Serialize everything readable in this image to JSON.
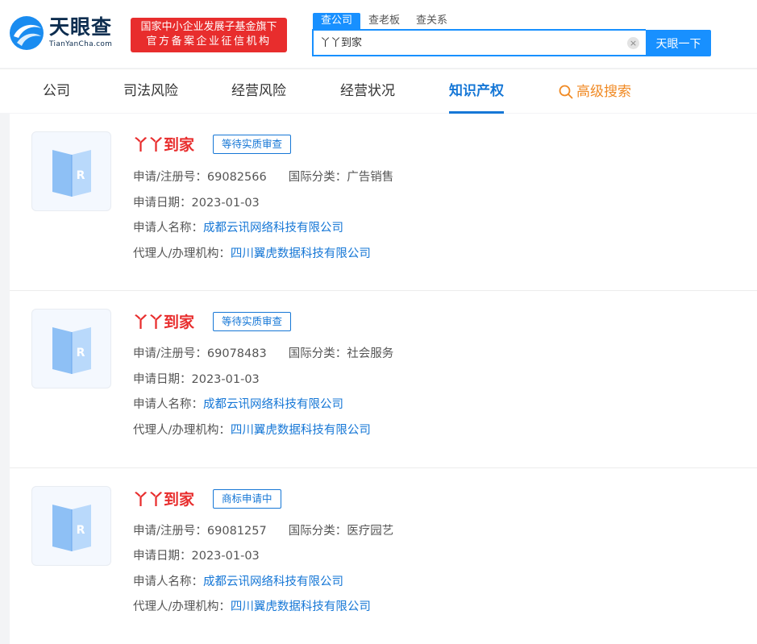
{
  "header": {
    "logo_cn": "天眼查",
    "logo_en": "TianYanCha.com",
    "slogan_line1": "国家中小企业发展子基金旗下",
    "slogan_line2": "官方备案企业征信机构"
  },
  "search": {
    "tabs": [
      "查公司",
      "查老板",
      "查关系"
    ],
    "value": "丫丫到家",
    "clear": "×",
    "button": "天眼一下"
  },
  "nav": {
    "items": [
      "公司",
      "司法风险",
      "经营风险",
      "经营状况",
      "知识产权",
      "高级搜索"
    ],
    "active": "知识产权"
  },
  "labels": {
    "reg_no": "申请/注册号：",
    "intl_class": "国际分类：",
    "apply_date": "申请日期：",
    "applicant": "申请人名称：",
    "agent": "代理人/办理机构："
  },
  "results": [
    {
      "name": "丫丫到家",
      "status": "等待实质审查",
      "reg_no": "69082566",
      "intl_class": "广告销售",
      "apply_date": "2023-01-03",
      "applicant": "成都云讯网络科技有限公司",
      "agent": "四川翼虎数据科技有限公司"
    },
    {
      "name": "丫丫到家",
      "status": "等待实质审查",
      "reg_no": "69078483",
      "intl_class": "社会服务",
      "apply_date": "2023-01-03",
      "applicant": "成都云讯网络科技有限公司",
      "agent": "四川翼虎数据科技有限公司"
    },
    {
      "name": "丫丫到家",
      "status": "商标申请中",
      "reg_no": "69081257",
      "intl_class": "医疗园艺",
      "apply_date": "2023-01-03",
      "applicant": "成都云讯网络科技有限公司",
      "agent": "四川翼虎数据科技有限公司"
    }
  ],
  "colors": {
    "brand_blue": "#1890ff",
    "brand_red": "#e82d2d",
    "link_blue": "#1677d6",
    "accent_orange": "#f08a24"
  },
  "icons": {
    "logo": "tianyancha-logo-icon",
    "thumb": "trademark-book-icon",
    "advanced_search": "search-icon",
    "clear": "clear-icon"
  }
}
